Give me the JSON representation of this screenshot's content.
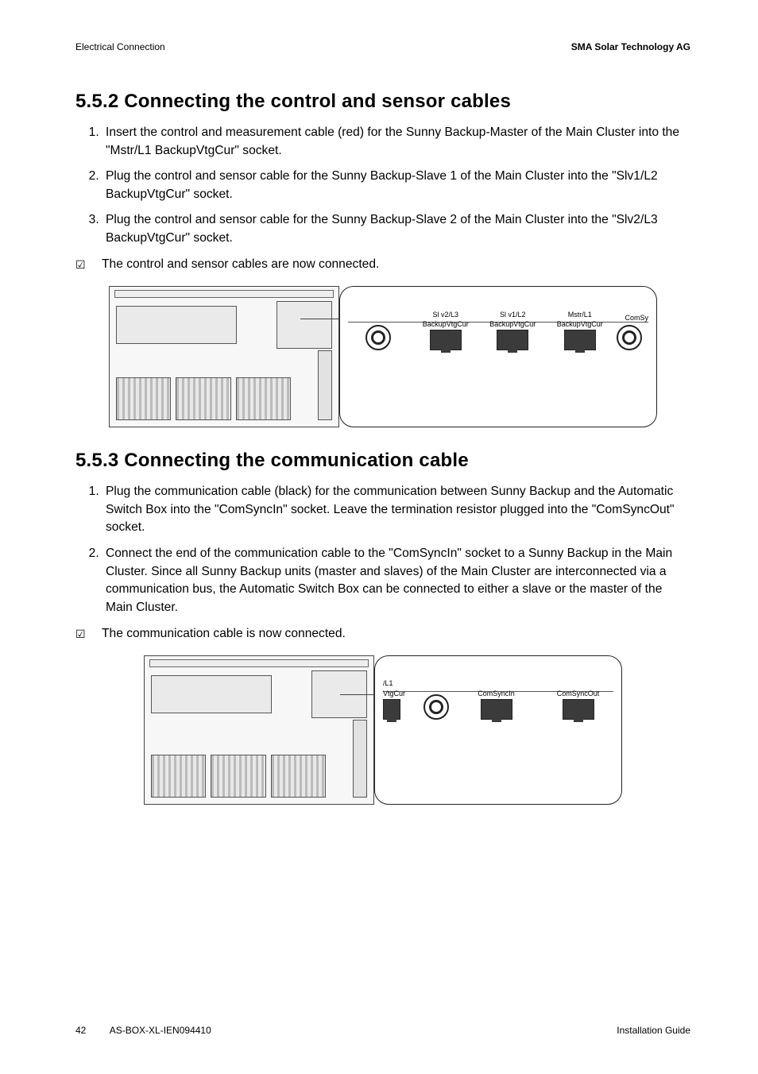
{
  "header": {
    "left": "Electrical Connection",
    "right": "SMA Solar Technology AG"
  },
  "sec552": {
    "title": "5.5.2 Connecting the control and sensor cables",
    "steps": [
      "Insert the control and measurement cable (red) for the Sunny Backup-Master of the Main Cluster into the \"Mstr/L1 BackupVtgCur\" socket.",
      "Plug the control and sensor cable for the Sunny Backup-Slave 1 of the Main Cluster into the \"Slv1/L2 BackupVtgCur\" socket.",
      "Plug the control and sensor cable for the Sunny Backup-Slave 2 of the Main Cluster into the \"Slv2/L3 BackupVtgCur\" socket."
    ],
    "result": "The control and sensor cables are now connected.",
    "fig": {
      "slots": [
        {
          "line1": "Sl v2/L3",
          "line2": "BackupVtgCur"
        },
        {
          "line1": "Sl v1/L2",
          "line2": "BackupVtgCur"
        },
        {
          "line1": "Mstr/L1",
          "line2": "BackupVtgCur"
        }
      ],
      "cut_label": "ComSy"
    }
  },
  "sec553": {
    "title": "5.5.3 Connecting the communication cable",
    "steps": [
      "Plug the communication cable (black) for the communication between Sunny Backup and the Automatic Switch Box into the \"ComSyncIn\" socket. Leave the termination resistor plugged into the \"ComSyncOut\" socket.",
      "Connect the end of the communication cable to the \"ComSyncIn\" socket to a Sunny Backup in the Main Cluster. Since all Sunny Backup units (master and slaves) of the Main Cluster are interconnected via a communication bus, the Automatic Switch Box can be connected to either a slave or the master of the Main Cluster."
    ],
    "result": "The communication cable is now connected.",
    "fig": {
      "left_cut": {
        "line1": "/L1",
        "line2": "VtgCur"
      },
      "slots": [
        {
          "line1": "ComSyncIn"
        },
        {
          "line1": "ComSyncOut"
        }
      ]
    }
  },
  "footer": {
    "page": "42",
    "doc": "AS-BOX-XL-IEN094410",
    "right": "Installation Guide"
  }
}
